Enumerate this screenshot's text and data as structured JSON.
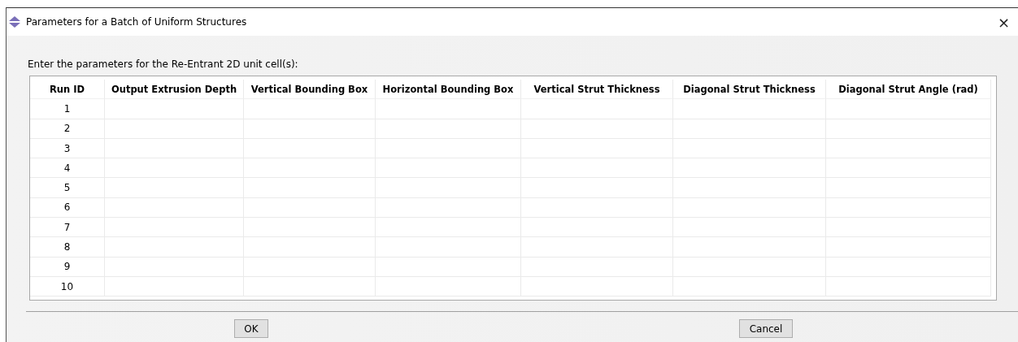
{
  "window": {
    "title": "Parameters for a Batch of Uniform Structures",
    "close": "×"
  },
  "prompt": "Enter the parameters for the Re-Entrant 2D unit cell(s):",
  "table": {
    "columns": [
      "Run ID",
      "Output Extrusion Depth",
      "Vertical Bounding Box",
      "Horizontal Bounding Box",
      "Vertical Strut Thickness",
      "Diagonal Strut Thickness",
      "Diagonal Strut Angle (rad)"
    ],
    "rows": [
      {
        "run_id": "1"
      },
      {
        "run_id": "2"
      },
      {
        "run_id": "3"
      },
      {
        "run_id": "4"
      },
      {
        "run_id": "5"
      },
      {
        "run_id": "6"
      },
      {
        "run_id": "7"
      },
      {
        "run_id": "8"
      },
      {
        "run_id": "9"
      },
      {
        "run_id": "10"
      }
    ]
  },
  "buttons": [
    "OK",
    "Cancel"
  ]
}
